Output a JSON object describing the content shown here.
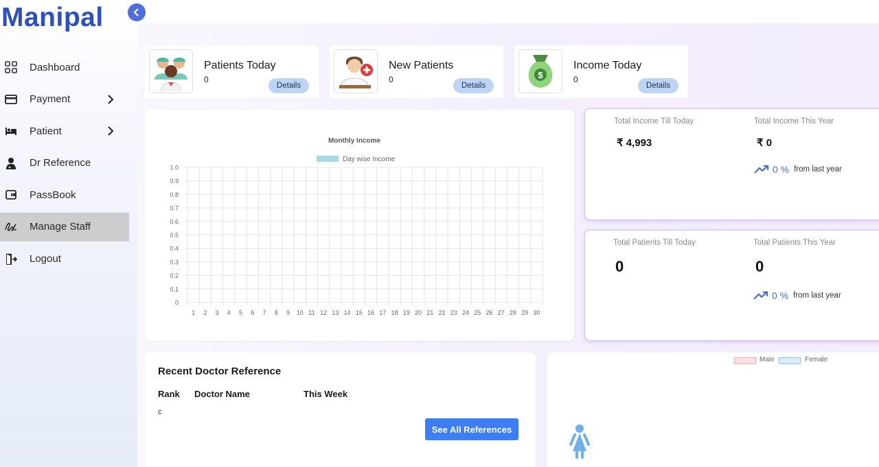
{
  "app": {
    "logo": "Manipal"
  },
  "sidebar": {
    "items": [
      {
        "label": "Dashboard",
        "icon": "grid-icon"
      },
      {
        "label": "Payment",
        "icon": "credit-card-icon",
        "has_submenu": true
      },
      {
        "label": "Patient",
        "icon": "bed-icon",
        "has_submenu": true
      },
      {
        "label": "Dr Reference",
        "icon": "doctor-icon"
      },
      {
        "label": "PassBook",
        "icon": "wallet-icon"
      },
      {
        "label": "Manage Staff",
        "icon": "signature-icon",
        "active": true
      },
      {
        "label": "Logout",
        "icon": "logout-icon"
      }
    ]
  },
  "stats": [
    {
      "title": "Patients Today",
      "value": "0",
      "button": "Details",
      "icon": "nurses-icon"
    },
    {
      "title": "New Patients",
      "value": "0",
      "button": "Details",
      "icon": "new-patient-icon"
    },
    {
      "title": "Income Today",
      "value": "0",
      "button": "Details",
      "icon": "money-bag-icon"
    }
  ],
  "chart_data": {
    "type": "bar",
    "title": "Monthly Income",
    "legend": "Day wise Income",
    "legend_color": "#a8d8e6",
    "categories": [
      "1",
      "2",
      "3",
      "4",
      "5",
      "6",
      "7",
      "8",
      "9",
      "10",
      "11",
      "12",
      "13",
      "14",
      "15",
      "16",
      "17",
      "18",
      "19",
      "20",
      "21",
      "22",
      "23",
      "24",
      "25",
      "26",
      "27",
      "28",
      "29",
      "30"
    ],
    "series": [
      {
        "name": "Day wise Income",
        "values": [
          0,
          0,
          0,
          0,
          0,
          0,
          0,
          0,
          0,
          0,
          0,
          0,
          0,
          0,
          0,
          0,
          0,
          0,
          0,
          0,
          0,
          0,
          0,
          0,
          0,
          0,
          0,
          0,
          0,
          0
        ]
      }
    ],
    "yticks": [
      "1.0",
      "0.9",
      "0.8",
      "0.7",
      "0.6",
      "0.5",
      "0.4",
      "0.3",
      "0.2",
      "0.1",
      "0"
    ],
    "ylim": [
      0,
      1
    ],
    "grid": true,
    "legend_position": "top-center"
  },
  "income": {
    "total_label": "Total Income Till Today",
    "total_value": "₹ 4,993",
    "year_label": "Total Income This Year",
    "year_value": "₹ 0",
    "trend_pct": "0 %",
    "trend_text": "from last year"
  },
  "patients": {
    "total_label": "Total Patients Till Today",
    "total_value": "0",
    "year_label": "Total Patients This Year",
    "year_value": "0",
    "trend_pct": "0 %",
    "trend_text": "from last year"
  },
  "references": {
    "title": "Recent Doctor Reference",
    "columns": [
      "Rank",
      "Doctor Name",
      "This Week"
    ],
    "cell": "c",
    "button": "See All References"
  },
  "gender": {
    "legend": [
      {
        "label": "Male",
        "color": "#f7c9d2"
      },
      {
        "label": "Female",
        "color": "#c8e4f7"
      }
    ],
    "icon": "female-icon"
  },
  "colors": {
    "accent": "#3c7ef5",
    "brand": "#2c50c0",
    "trend": "#4b6fd6"
  }
}
